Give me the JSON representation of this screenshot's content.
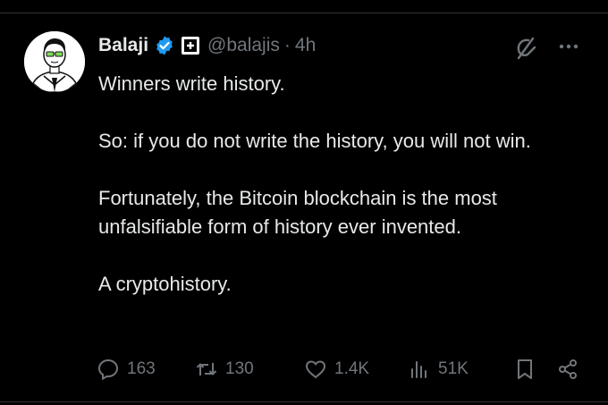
{
  "author": {
    "name": "Balaji",
    "handle": "@balajis",
    "separator": "·",
    "time": "4h",
    "accent": "#1d9bf0"
  },
  "tweet": {
    "paragraphs": [
      "Winners write history.",
      "So: if you do not write the history, you will not win.",
      "Fortunately, the Bitcoin blockchain is the most unfalsifiable form of history ever invented.",
      "A cryptohistory."
    ]
  },
  "actions": {
    "reply_count": "163",
    "retweet_count": "130",
    "like_count": "1.4K",
    "views_count": "51K"
  },
  "icons": {
    "verified": "verified-badge-icon",
    "affiliation": "affiliation-badge-icon",
    "grok": "grok-icon",
    "more": "more-dots-icon",
    "reply": "reply-icon",
    "retweet": "retweet-icon",
    "like": "heart-icon",
    "views": "views-chart-icon",
    "bookmark": "bookmark-icon",
    "share": "share-icon"
  }
}
